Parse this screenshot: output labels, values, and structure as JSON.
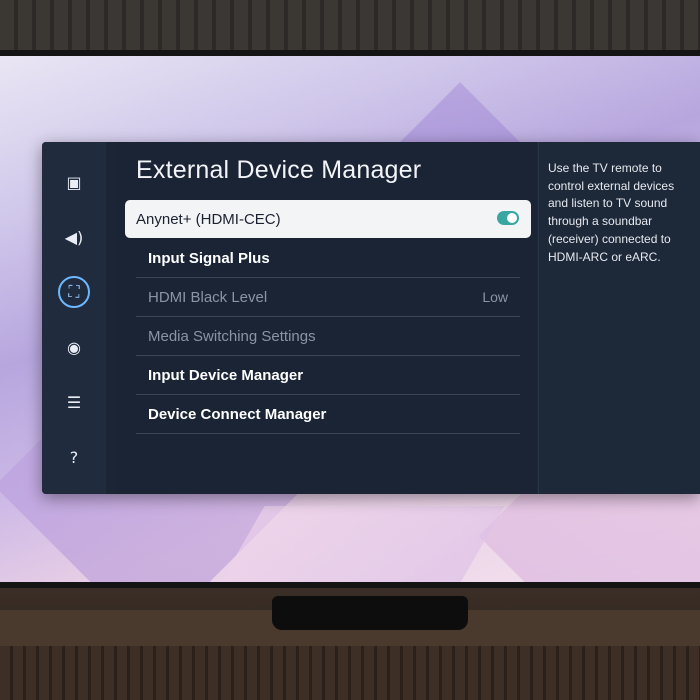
{
  "sidebar": {
    "items": [
      {
        "icon": "picture-icon",
        "glyph": "▣"
      },
      {
        "icon": "sound-icon",
        "glyph": "◀)"
      },
      {
        "icon": "connection-icon",
        "glyph": "⛶"
      },
      {
        "icon": "broadcast-icon",
        "glyph": "◉"
      },
      {
        "icon": "general-icon",
        "glyph": "☰"
      },
      {
        "icon": "support-icon",
        "glyph": "?"
      }
    ],
    "active_index": 2
  },
  "main": {
    "title": "External Device Manager",
    "items": [
      {
        "label": "Anynet+ (HDMI-CEC)",
        "toggle_on": true
      },
      {
        "label": "Input Signal Plus"
      },
      {
        "label": "HDMI Black Level",
        "value": "Low"
      },
      {
        "label": "Media Switching Settings"
      },
      {
        "label": "Input Device Manager"
      },
      {
        "label": "Device Connect Manager"
      }
    ]
  },
  "help": {
    "text": "Use the TV remote to control external devices and listen to TV sound through a soundbar (receiver) connected to HDMI-ARC or eARC."
  },
  "colors": {
    "panel_bg": "#1b2536",
    "highlight": "#f3f4f6",
    "toggle_on": "#3aa6a1",
    "active_icon_ring": "#6cb8ff"
  }
}
